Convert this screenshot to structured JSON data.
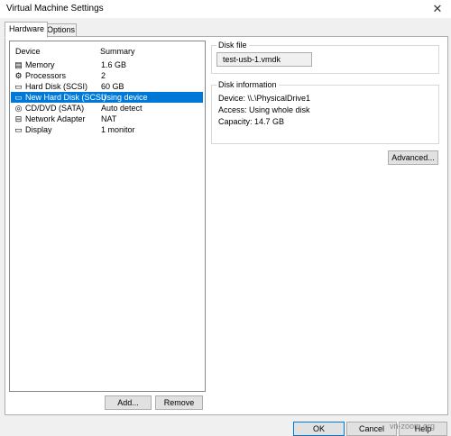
{
  "window": {
    "title": "Virtual Machine Settings",
    "close_glyph": "✕"
  },
  "tabs": [
    {
      "label": "Hardware"
    },
    {
      "label": "Options"
    }
  ],
  "device_list": {
    "headers": {
      "device": "Device",
      "summary": "Summary"
    },
    "rows": [
      {
        "name": "Memory",
        "summary": "1.6 GB",
        "icon": "memory-icon",
        "glyph": "▤"
      },
      {
        "name": "Processors",
        "summary": "2",
        "icon": "processor-icon",
        "glyph": "⚙"
      },
      {
        "name": "Hard Disk (SCSI)",
        "summary": "60 GB",
        "icon": "hard-disk-icon",
        "glyph": "▭"
      },
      {
        "name": "New Hard Disk (SCSI)",
        "summary": "Using device",
        "icon": "hard-disk-icon",
        "glyph": "▭",
        "selected": true
      },
      {
        "name": "CD/DVD (SATA)",
        "summary": "Auto detect",
        "icon": "cd-dvd-icon",
        "glyph": "◎"
      },
      {
        "name": "Network Adapter",
        "summary": "NAT",
        "icon": "network-adapter-icon",
        "glyph": "⊟"
      },
      {
        "name": "Display",
        "summary": "1 monitor",
        "icon": "display-icon",
        "glyph": "▭"
      }
    ]
  },
  "list_buttons": {
    "add": "Add...",
    "remove": "Remove"
  },
  "disk_file": {
    "legend": "Disk file",
    "value": "test-usb-1.vmdk"
  },
  "disk_info": {
    "legend": "Disk information",
    "device": "Device:  \\\\.\\PhysicalDrive1",
    "access": "Access:  Using whole disk",
    "capacity": "Capacity:  14.7 GB"
  },
  "advanced_button": "Advanced...",
  "footer": {
    "ok": "OK",
    "cancel": "Cancel",
    "help": "Help"
  },
  "watermark": "vn-zoom.org",
  "colors": {
    "selection": "#0078d7",
    "background": "#f0f0f0"
  }
}
